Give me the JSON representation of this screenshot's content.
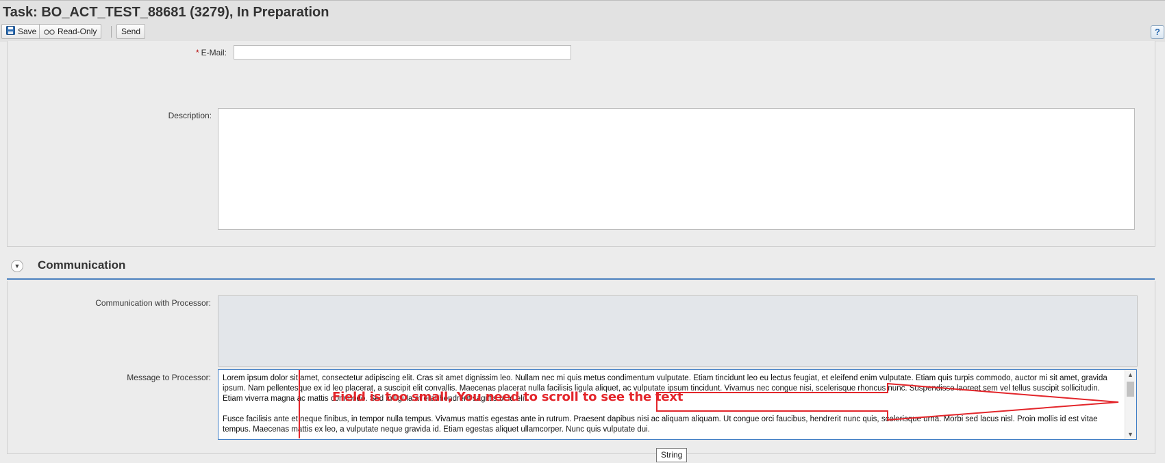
{
  "window": {
    "title": "Task: BO_ACT_TEST_88681 (3279), In Preparation"
  },
  "toolbar": {
    "save_label": "Save",
    "readonly_label": "Read-Only",
    "send_label": "Send",
    "help_label": "?"
  },
  "form": {
    "email": {
      "label": "E-Mail:",
      "required_mark": "*",
      "value": ""
    },
    "description": {
      "label": "Description:",
      "value": ""
    }
  },
  "communication": {
    "section_title": "Communication",
    "collapse_glyph": "▼",
    "with_processor_label": "Communication with Processor:",
    "message_label": "Message to Processor:",
    "message_paragraphs": [
      "Lorem ipsum dolor sit amet, consectetur adipiscing elit. Cras sit amet dignissim leo. Nullam nec mi quis metus condimentum vulputate. Etiam tincidunt leo eu lectus feugiat, et eleifend enim vulputate. Etiam quis turpis commodo, auctor mi sit amet, gravida ipsum. Nam pellentesque ex id leo placerat, a suscipit elit convallis. Maecenas placerat nulla facilisis ligula aliquet, ac vulputate ipsum tincidunt. Vivamus nec congue nisi, scelerisque rhoncus nunc. Suspendisse laoreet sem vel tellus suscipit sollicitudin. Etiam viverra magna ac mattis commodo. Sed in ligula at erat hendrerit sagittis ut id elit.",
      "Fusce facilisis ante et neque finibus, in tempor nulla tempus. Vivamus mattis egestas ante in rutrum. Praesent dapibus nisi ac aliquam aliquam. Ut congue orci faucibus, hendrerit nunc quis, scelerisque urna. Morbi sed lacus nisl. Proin mollis id est vitae tempus. Maecenas mattis ex leo, a vulputate neque gravida id. Etiam egestas aliquet ullamcorper. Nunc quis vulputate dui."
    ],
    "tooltip": "String"
  },
  "annotation": {
    "text": "Field is too small, You need to scroll to see the text",
    "color": "#e3262b"
  },
  "colors": {
    "accent_line": "#4a80bf",
    "field_focus_border": "#3b7bc4"
  },
  "icons": [
    "save-icon",
    "glasses-icon",
    "help-icon",
    "collapse-icon",
    "scroll-up-icon",
    "scroll-down-icon"
  ]
}
